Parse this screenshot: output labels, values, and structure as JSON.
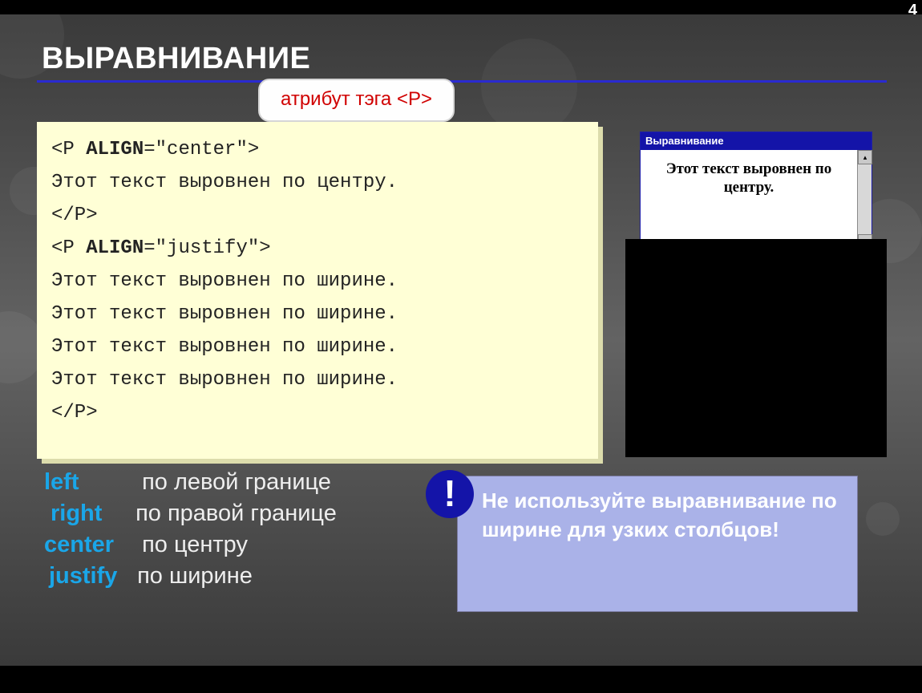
{
  "page_number": "4",
  "title": "ВЫРАВНИВАНИЕ",
  "callout": {
    "text": "атрибут тэга ",
    "tag": "<P>"
  },
  "code": {
    "l1a": "<P ",
    "l1b": "ALIGN",
    "l1c": "=\"center\">",
    "l2": "Этот текст выровнен по центру.",
    "l3": "</P>",
    "l4a": "<P ",
    "l4b": "ALIGN",
    "l4c": "=\"justify\">",
    "l5": "Этот текст выровнен по ширине.",
    "l6": "Этот текст выровнен по ширине.",
    "l7": "Этот текст выровнен по ширине.",
    "l8": "Этот текст выровнен по ширине.",
    "l9": "</P>"
  },
  "preview": {
    "title": "Выравнивание",
    "text": "Этот текст выровнен по центру.",
    "scroll_up_glyph": "▴",
    "scroll_down_glyph": "▾"
  },
  "align_list": {
    "left": {
      "key": "left",
      "desc": "по левой границе"
    },
    "right": {
      "key": "right",
      "desc": "по правой границе"
    },
    "center": {
      "key": "center",
      "desc": "по центру"
    },
    "justify": {
      "key": "justify",
      "desc": "по ширине"
    }
  },
  "warning": {
    "mark": "!",
    "text": "Не используйте выравнивание по ширине для узких столбцов!"
  }
}
